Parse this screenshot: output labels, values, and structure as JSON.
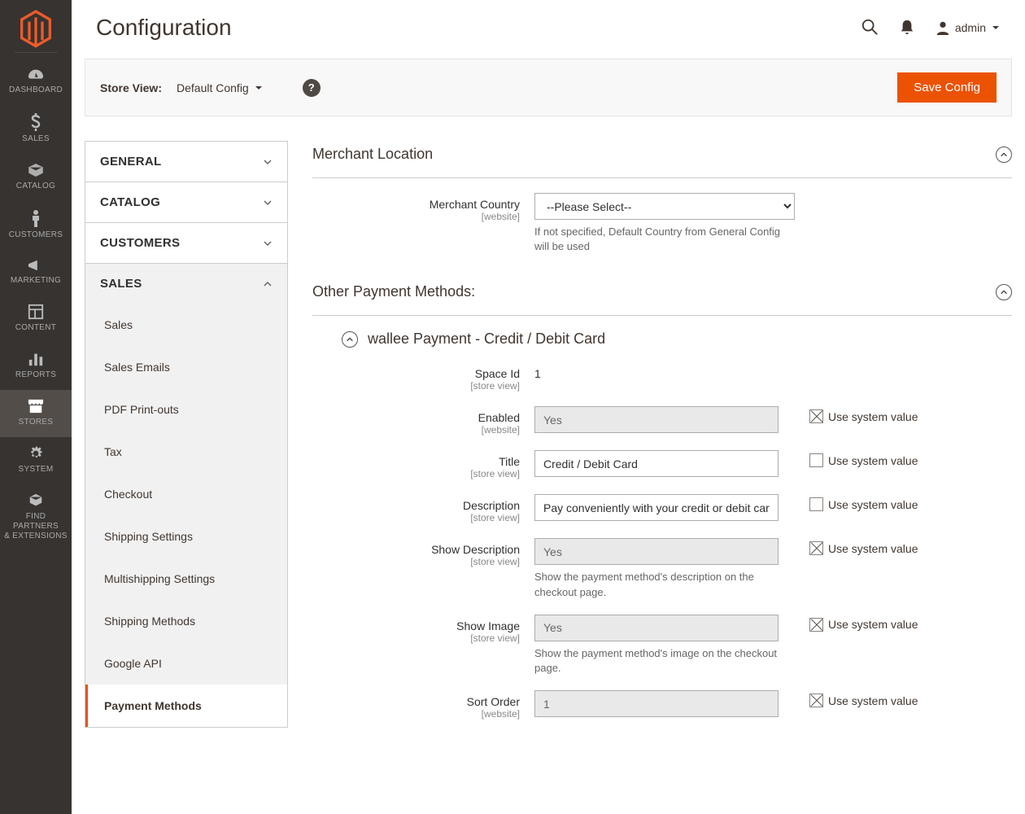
{
  "sidebar": {
    "items": [
      {
        "label": "DASHBOARD"
      },
      {
        "label": "SALES"
      },
      {
        "label": "CATALOG"
      },
      {
        "label": "CUSTOMERS"
      },
      {
        "label": "MARKETING"
      },
      {
        "label": "CONTENT"
      },
      {
        "label": "REPORTS"
      },
      {
        "label": "STORES"
      },
      {
        "label": "SYSTEM"
      },
      {
        "label": "FIND PARTNERS",
        "label2": "& EXTENSIONS"
      }
    ]
  },
  "header": {
    "title": "Configuration",
    "user": "admin"
  },
  "toolbar": {
    "store_view_label": "Store View:",
    "store_view_value": "Default Config",
    "save_button": "Save Config"
  },
  "config_nav": {
    "sections": [
      {
        "label": "GENERAL"
      },
      {
        "label": "CATALOG"
      },
      {
        "label": "CUSTOMERS"
      },
      {
        "label": "SALES"
      }
    ],
    "sales_items": [
      {
        "label": "Sales"
      },
      {
        "label": "Sales Emails"
      },
      {
        "label": "PDF Print-outs"
      },
      {
        "label": "Tax"
      },
      {
        "label": "Checkout"
      },
      {
        "label": "Shipping Settings"
      },
      {
        "label": "Multishipping Settings"
      },
      {
        "label": "Shipping Methods"
      },
      {
        "label": "Google API"
      },
      {
        "label": "Payment Methods"
      }
    ]
  },
  "merchant_location": {
    "title": "Merchant Location",
    "country_label": "Merchant Country",
    "country_scope": "[website]",
    "country_value": "--Please Select--",
    "country_note": "If not specified, Default Country from General Config will be used"
  },
  "other_methods": {
    "title": "Other Payment Methods:",
    "sub_title": "wallee Payment - Credit / Debit Card",
    "use_system_value": "Use system value",
    "fields": {
      "space_id": {
        "label": "Space Id",
        "scope": "[store view]",
        "value": "1"
      },
      "enabled": {
        "label": "Enabled",
        "scope": "[website]",
        "value": "Yes"
      },
      "title": {
        "label": "Title",
        "scope": "[store view]",
        "value": "Credit / Debit Card"
      },
      "description": {
        "label": "Description",
        "scope": "[store view]",
        "value": "Pay conveniently with your credit or debit card."
      },
      "show_description": {
        "label": "Show Description",
        "scope": "[store view]",
        "value": "Yes",
        "note": "Show the payment method's description on the checkout page."
      },
      "show_image": {
        "label": "Show Image",
        "scope": "[store view]",
        "value": "Yes",
        "note": "Show the payment method's image on the checkout page."
      },
      "sort_order": {
        "label": "Sort Order",
        "scope": "[website]",
        "value": "1"
      }
    }
  }
}
